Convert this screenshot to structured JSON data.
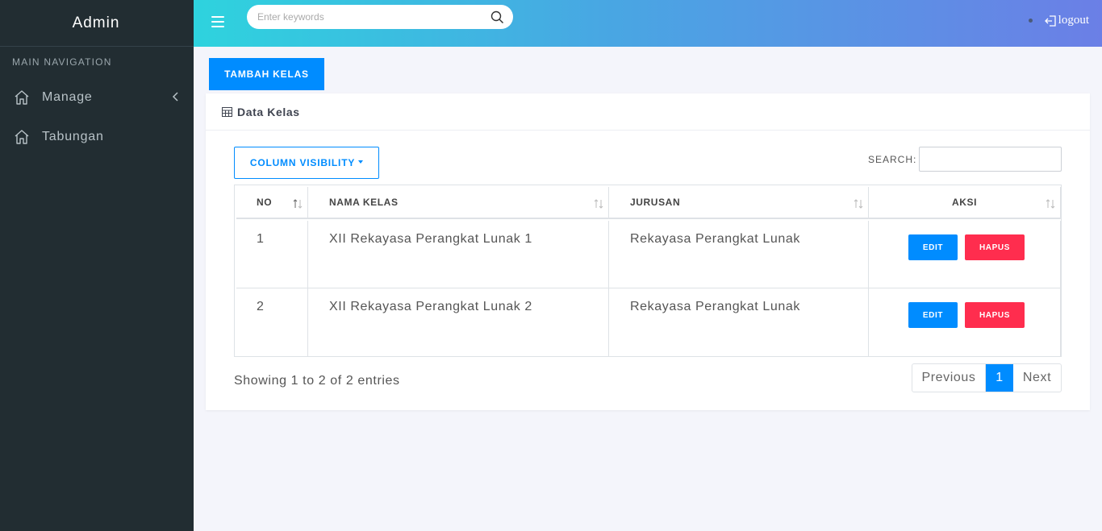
{
  "sidebar": {
    "brand": "Admin",
    "nav_header": "MAIN NAVIGATION",
    "items": [
      {
        "label": "Manage",
        "icon": "home-icon",
        "has_submenu": true
      },
      {
        "label": "Tabungan",
        "icon": "home-icon",
        "has_submenu": false
      }
    ]
  },
  "topbar": {
    "search_placeholder": "Enter keywords",
    "logout_label": "logout",
    "colors": {
      "gradient_start": "#2ed3de",
      "gradient_end": "#6b7fe6"
    }
  },
  "main": {
    "add_button": "TAMBAH KELAS",
    "card_title": "Data Kelas",
    "column_visibility": "COLUMN VISIBILITY",
    "search_label": "SEARCH:",
    "search_value": "",
    "table": {
      "columns": [
        "NO",
        "NAMA KELAS",
        "JURUSAN",
        "AKSI"
      ],
      "rows": [
        {
          "no": "1",
          "nama_kelas": "XII Rekayasa Perangkat Lunak 1",
          "jurusan": "Rekayasa Perangkat Lunak"
        },
        {
          "no": "2",
          "nama_kelas": "XII Rekayasa Perangkat Lunak 2",
          "jurusan": "Rekayasa Perangkat Lunak"
        }
      ],
      "edit_label": "EDIT",
      "delete_label": "HAPUS"
    },
    "info": "Showing 1 to 2 of 2 entries",
    "pagination": {
      "previous": "Previous",
      "current": "1",
      "next": "Next"
    },
    "colors": {
      "primary": "#008cff",
      "danger": "#ff2d4e"
    }
  }
}
